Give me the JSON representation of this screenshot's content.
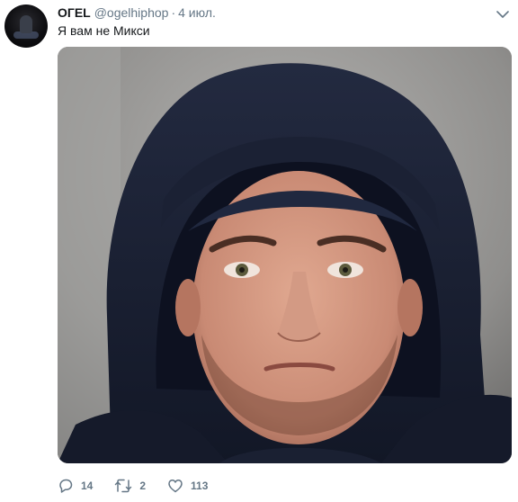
{
  "tweet": {
    "author_name": "ОГЕL",
    "author_handle": "@ogelhiphop",
    "separator": "·",
    "date": "4 июл.",
    "text": "Я вам не Микси",
    "media_icon": "photo",
    "caret_icon": "chevron-down-icon"
  },
  "actions": {
    "reply_icon": "reply-icon",
    "reply_count": "14",
    "retweet_icon": "retweet-icon",
    "retweet_count": "2",
    "like_icon": "heart-icon",
    "like_count": "113"
  },
  "colors": {
    "text_primary": "#14171a",
    "text_secondary": "#657786",
    "background": "#ffffff"
  }
}
